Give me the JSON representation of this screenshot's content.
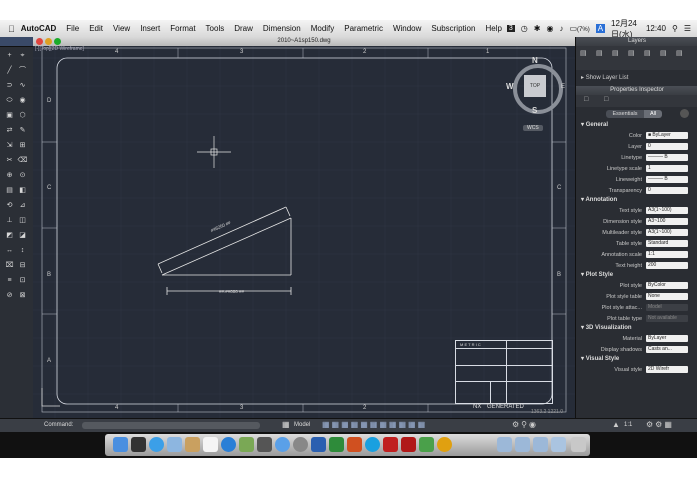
{
  "menubar": {
    "app": "AutoCAD",
    "items": [
      "File",
      "Edit",
      "View",
      "Insert",
      "Format",
      "Tools",
      "Draw",
      "Dimension",
      "Modify",
      "Parametric",
      "Window",
      "Subscription",
      "Help"
    ],
    "battery": "(7%)",
    "input_method": "A",
    "date": "12月24日(水)",
    "time": "12:40"
  },
  "document": {
    "title": "2010~A1sp150.dwg",
    "viewport_label": "[-][Top][2D Wireframe]"
  },
  "drawing": {
    "col_labels": [
      "4",
      "3",
      "2",
      "1"
    ],
    "row_labels": [
      "D",
      "C",
      "B",
      "A"
    ],
    "viewcube": {
      "top": "TOP",
      "north": "N",
      "south": "S",
      "east": "E",
      "west": "W",
      "wcs": "WCS"
    },
    "dim_slope": "##6250 ##",
    "dim_base": "##.##000 ##",
    "titleblock_header": "M E T R I C",
    "nx_label": "NX",
    "generated_label": "GENERATED",
    "coords": "1363.2 1221.0"
  },
  "statusbar": {
    "command_label": "Command:",
    "model_tab": "Model",
    "scale": "1:1"
  },
  "layers_panel": {
    "title": "Layers",
    "show_layer_list": "Show Layer List"
  },
  "properties": {
    "title": "Properties Inspector",
    "tab_essentials": "Essentials",
    "tab_all": "All",
    "sections": {
      "general": {
        "title": "General",
        "rows": [
          {
            "label": "Color",
            "value": "■ ByLayer"
          },
          {
            "label": "Layer",
            "value": "0"
          },
          {
            "label": "Linetype",
            "value": "——— B"
          },
          {
            "label": "Linetype scale",
            "value": "1"
          },
          {
            "label": "Lineweight",
            "value": "——— B"
          },
          {
            "label": "Transparency",
            "value": "0"
          }
        ]
      },
      "annotation": {
        "title": "Annotation",
        "rows": [
          {
            "label": "Text style",
            "value": "A3(1~100)"
          },
          {
            "label": "Dimension style",
            "value": "A3~100"
          },
          {
            "label": "Multileader style",
            "value": "A3(1~100)"
          },
          {
            "label": "Table style",
            "value": "Standard"
          },
          {
            "label": "Annotation scale",
            "value": "1:1"
          },
          {
            "label": "Text height",
            "value": "200"
          }
        ]
      },
      "plot": {
        "title": "Plot Style",
        "rows": [
          {
            "label": "Plot style",
            "value": "ByColor"
          },
          {
            "label": "Plot style table",
            "value": "None"
          },
          {
            "label": "Plot style attac...",
            "value": "Model",
            "disabled": true
          },
          {
            "label": "Plot table type",
            "value": "Not available",
            "disabled": true
          }
        ]
      },
      "viz": {
        "title": "3D Visualization",
        "rows": [
          {
            "label": "Material",
            "value": "ByLayer"
          },
          {
            "label": "Display shadows",
            "value": "Casts an..."
          }
        ]
      },
      "visual": {
        "title": "Visual Style",
        "rows": [
          {
            "label": "Visual style",
            "value": "2D Wirefr"
          }
        ]
      }
    }
  }
}
